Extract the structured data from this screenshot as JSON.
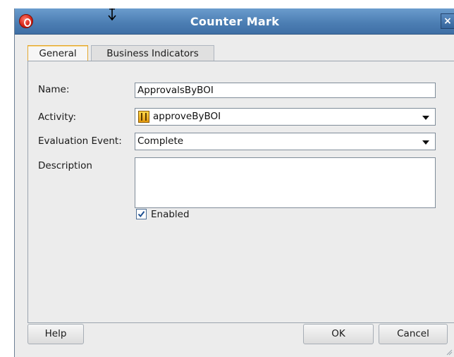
{
  "window": {
    "title": "Counter Mark",
    "close_glyph": "×",
    "app_icon": "oracle-icon"
  },
  "tabs": [
    {
      "label": "General",
      "selected": true
    },
    {
      "label": "Business Indicators",
      "selected": false
    }
  ],
  "form": {
    "name_label": "Name:",
    "name_value": "ApprovalsByBOI",
    "activity_label": "Activity:",
    "activity_value": "approveByBOI",
    "activity_icon": "activity-icon",
    "evaluation_label": "Evaluation Event:",
    "evaluation_value": "Complete",
    "description_label": "Description",
    "description_value": "",
    "enabled_label": "Enabled",
    "enabled_checked": true
  },
  "buttons": {
    "help": "Help",
    "ok": "OK",
    "cancel": "Cancel"
  },
  "colors": {
    "titlebar": "#4d7fb4",
    "selected_tab_border": "#e4a830",
    "background": "#ececec"
  }
}
